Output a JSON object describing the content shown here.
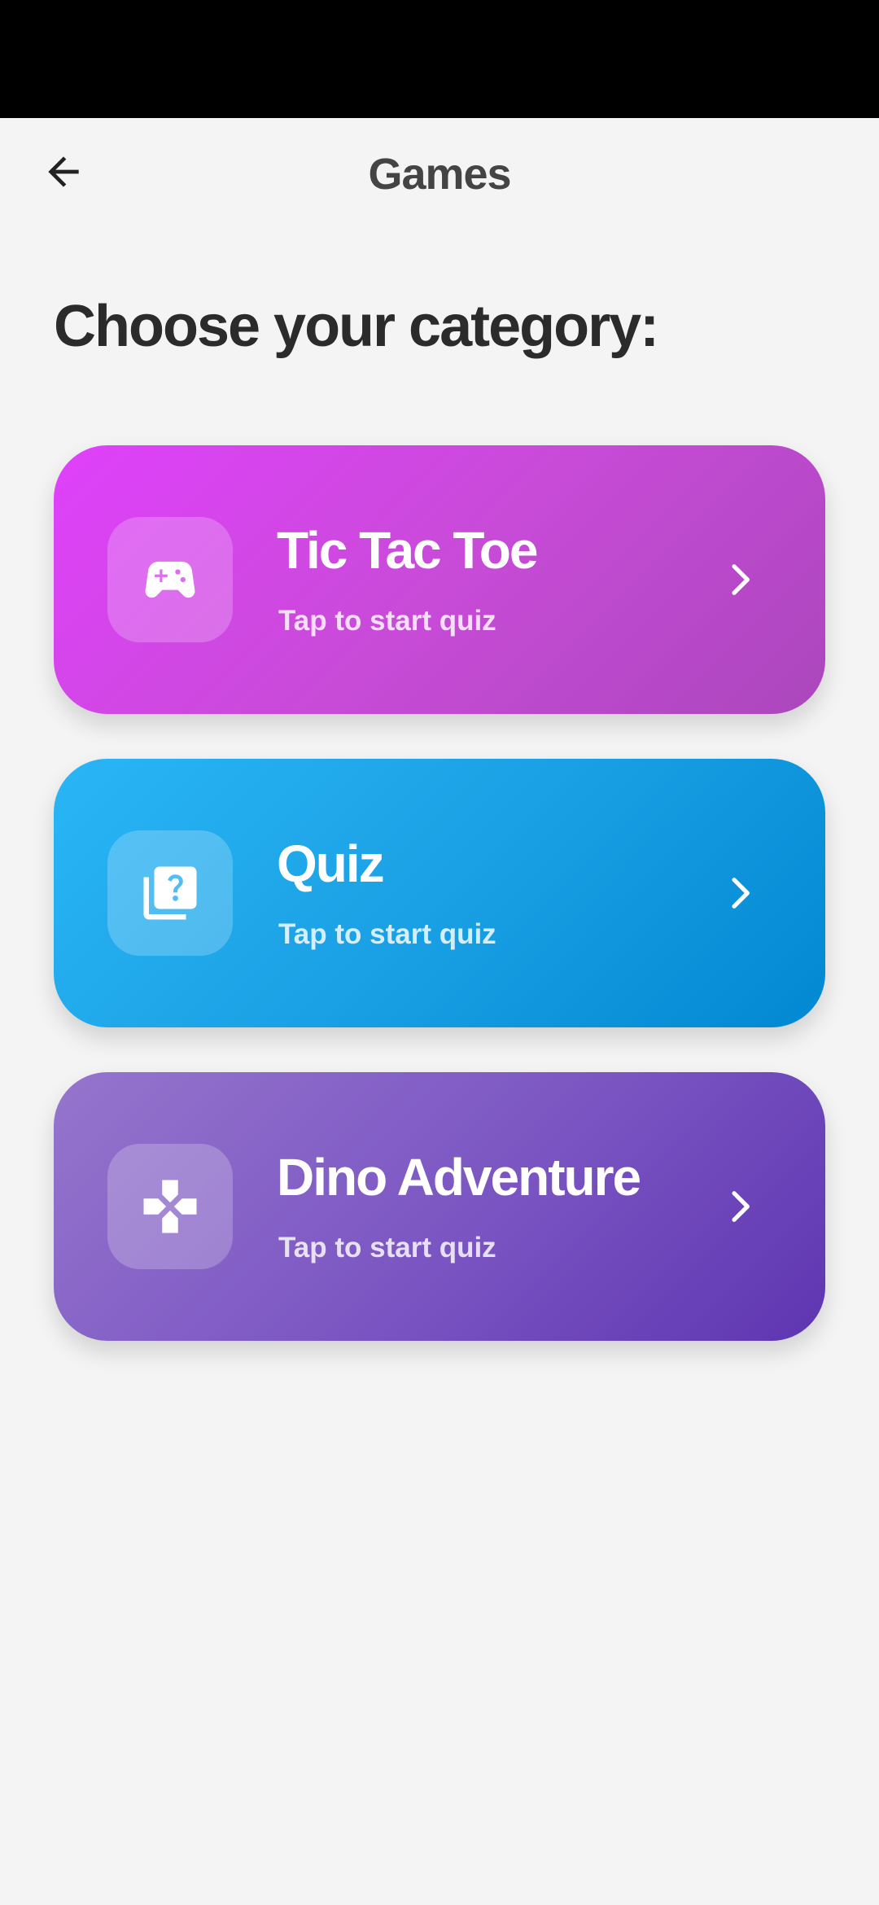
{
  "app_bar": {
    "title": "Games",
    "back_icon": "arrow-left-icon"
  },
  "heading": "Choose your category:",
  "categories": [
    {
      "title": "Tic Tac Toe",
      "subtitle": "Tap to start quiz",
      "icon": "gamepad-icon",
      "gradient": [
        "#e040fb",
        "#ab47bc"
      ]
    },
    {
      "title": "Quiz",
      "subtitle": "Tap to start quiz",
      "icon": "quiz-icon",
      "gradient": [
        "#29b6f6",
        "#0288d1"
      ]
    },
    {
      "title": "Dino Adventure",
      "subtitle": "Tap to start quiz",
      "icon": "dpad-icon",
      "gradient": [
        "#9575cd",
        "#5e35b1"
      ]
    }
  ],
  "chevron_icon": "chevron-right-icon",
  "colors": {
    "background": "#f4f4f4",
    "status_bar": "#000000",
    "title_text": "#444444",
    "heading_text": "#2b2b2b"
  }
}
